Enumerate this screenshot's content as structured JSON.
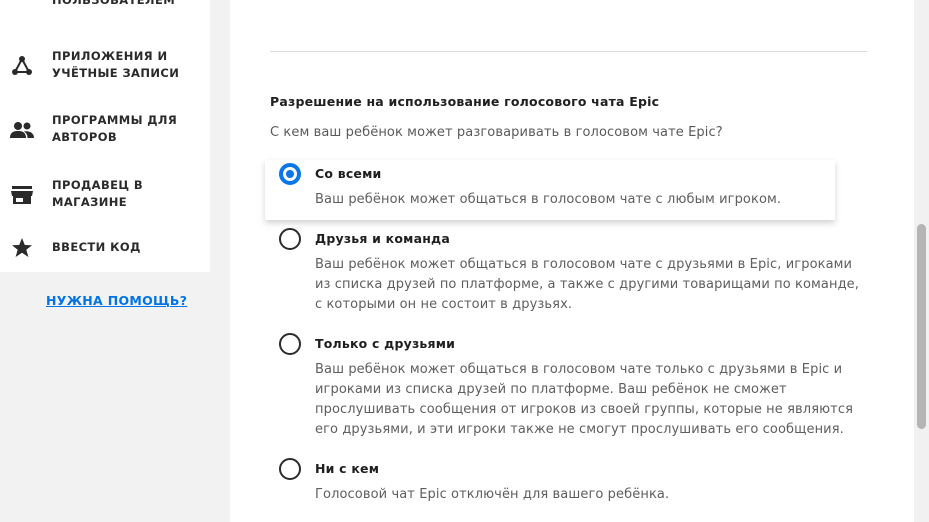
{
  "sidebar": {
    "items": [
      {
        "label": "ПОЛЬЗОВАТЕЛЕМ",
        "icon": "user-icon"
      },
      {
        "label": "ПРИЛОЖЕНИЯ И УЧЁТНЫЕ ЗАПИСИ",
        "icon": "connections-icon"
      },
      {
        "label": "ПРОГРАММЫ ДЛЯ АВТОРОВ",
        "icon": "people-icon"
      },
      {
        "label": "ПРОДАВЕЦ В МАГАЗИНЕ",
        "icon": "store-icon"
      },
      {
        "label": "ВВЕСТИ КОД",
        "icon": "star-icon"
      }
    ],
    "help_link": "НУЖНА ПОМОЩЬ?"
  },
  "voice_chat": {
    "title": "Разрешение на использование голосового чата Epic",
    "question": "С кем ваш ребёнок может разговаривать в голосовом чате Epic?",
    "options": [
      {
        "title": "Со всеми",
        "description": "Ваш ребёнок может общаться в голосовом чате с любым игроком.",
        "selected": true
      },
      {
        "title": "Друзья и команда",
        "description": "Ваш ребёнок может общаться в голосовом чате с друзьями в Epic, игроками из списка друзей по платформе, а также с другими товарищами по команде, с которыми он не состоит в друзьях.",
        "selected": false
      },
      {
        "title": "Только с друзьями",
        "description": "Ваш ребёнок может общаться в голосовом чате только с друзьями в Epic и игроками из списка друзей по платформе. Ваш ребёнок не сможет прослушивать сообщения от игроков из своей группы, которые не являются его друзьями, и эти игроки также не смогут прослушивать его сообщения.",
        "selected": false
      },
      {
        "title": "Ни с кем",
        "description": "Голосовой чат Epic отключён для вашего ребёнка.",
        "selected": false
      }
    ]
  },
  "colors": {
    "accent": "#0a76e8",
    "link": "#0074e4",
    "background": "#f2f2f2"
  }
}
